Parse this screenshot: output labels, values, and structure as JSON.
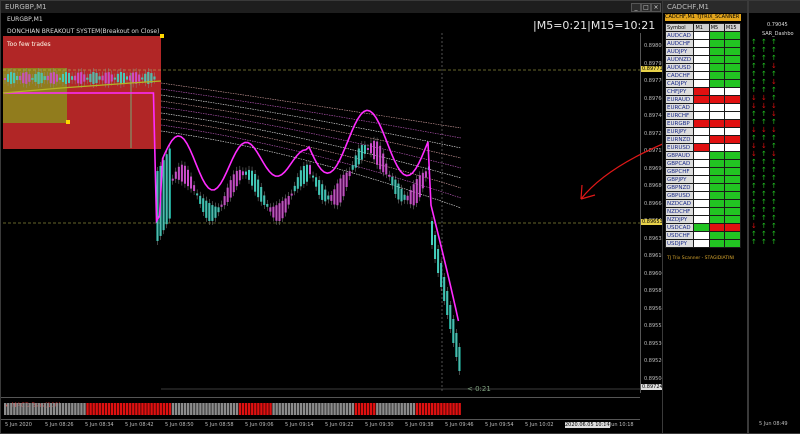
{
  "chart_window": {
    "title": "EURGBP,M1",
    "legend_line1": "EURGBP,M1",
    "indicator_name": "DONCHIAN BREAKOUT SYSTEM(Breakout on Close)",
    "box_label": "Too few trades",
    "timer_text": "|M5=0:21|M15=10:21",
    "countdown_label": "< 0:21",
    "macd_label": "► MACD Bars(100)",
    "price_axis": [
      "0.89808",
      "0.89792",
      "0.89776",
      "0.89760",
      "0.89744",
      "0.89728",
      "0.89712",
      "0.89696",
      "0.89680",
      "0.89664",
      "0.89648",
      "0.89632",
      "0.89616",
      "0.89600",
      "0.89584",
      "0.89568",
      "0.89552",
      "0.89536",
      "0.89520",
      "0.89504"
    ],
    "price_marker_upper": "0.89771",
    "price_marker_middle": "0.89653",
    "price_marker_lower": "0.89724",
    "time_axis": [
      "5 Jun 2020",
      "5 Jun 08:26",
      "5 Jun 08:34",
      "5 Jun 08:42",
      "5 Jun 08:50",
      "5 Jun 08:58",
      "5 Jun 09:06",
      "5 Jun 09:14",
      "5 Jun 09:22",
      "5 Jun 09:30",
      "5 Jun 09:38",
      "5 Jun 09:46",
      "5 Jun 09:54",
      "5 Jun 10:02",
      "2020.06.05 10:14",
      "5 Jun 10:18"
    ]
  },
  "scanner_window": {
    "title": "CADCHF,M1",
    "header": "CADCHF,M1 TJTRIX_SCANNER",
    "columns": [
      "Symbol",
      "M1",
      "M5",
      "M15"
    ],
    "rows": [
      {
        "symbol": "AUDCAD",
        "cells": [
          "w",
          "g",
          "g"
        ]
      },
      {
        "symbol": "AUDCHF",
        "cells": [
          "w",
          "g",
          "g"
        ]
      },
      {
        "symbol": "AUDJPY",
        "cells": [
          "w",
          "g",
          "g"
        ]
      },
      {
        "symbol": "AUDNZD",
        "cells": [
          "w",
          "g",
          "g"
        ]
      },
      {
        "symbol": "AUDUSD",
        "cells": [
          "w",
          "g",
          "g"
        ]
      },
      {
        "symbol": "CADCHF",
        "cells": [
          "w",
          "g",
          "g"
        ]
      },
      {
        "symbol": "CADJPY",
        "cells": [
          "w",
          "g",
          "g"
        ]
      },
      {
        "symbol": "CHFJPY",
        "cells": [
          "r",
          "w",
          "w"
        ]
      },
      {
        "symbol": "EURAUD",
        "cells": [
          "r",
          "r",
          "r"
        ]
      },
      {
        "symbol": "EURCAD",
        "cells": [
          "w",
          "w",
          "w"
        ]
      },
      {
        "symbol": "EURCHF",
        "cells": [
          "w",
          "w",
          "w"
        ]
      },
      {
        "symbol": "EURGBP",
        "cells": [
          "r",
          "r",
          "r"
        ]
      },
      {
        "symbol": "EURJPY",
        "cells": [
          "w",
          "w",
          "w"
        ]
      },
      {
        "symbol": "EURNZD",
        "cells": [
          "w",
          "r",
          "r"
        ]
      },
      {
        "symbol": "EURUSD",
        "cells": [
          "r",
          "w",
          "w"
        ]
      },
      {
        "symbol": "GBPAUD",
        "cells": [
          "w",
          "g",
          "g"
        ]
      },
      {
        "symbol": "GBPCAD",
        "cells": [
          "w",
          "g",
          "g"
        ]
      },
      {
        "symbol": "GBPCHF",
        "cells": [
          "w",
          "g",
          "g"
        ]
      },
      {
        "symbol": "GBPJPY",
        "cells": [
          "w",
          "g",
          "g"
        ]
      },
      {
        "symbol": "GBPNZD",
        "cells": [
          "w",
          "g",
          "g"
        ]
      },
      {
        "symbol": "GBPUSD",
        "cells": [
          "w",
          "g",
          "g"
        ]
      },
      {
        "symbol": "NZDCAD",
        "cells": [
          "w",
          "g",
          "g"
        ]
      },
      {
        "symbol": "NZDCHF",
        "cells": [
          "w",
          "g",
          "g"
        ]
      },
      {
        "symbol": "NZDJPY",
        "cells": [
          "w",
          "g",
          "g"
        ]
      },
      {
        "symbol": "USDCAD",
        "cells": [
          "g",
          "r",
          "r"
        ]
      },
      {
        "symbol": "USDCHF",
        "cells": [
          "w",
          "g",
          "g"
        ]
      },
      {
        "symbol": "USDJPY",
        "cells": [
          "w",
          "g",
          "g"
        ]
      }
    ],
    "footer": "TJ Trix Scanner - STAGIDIATINI"
  },
  "dashboard_window": {
    "label": "SAR_Dashbo",
    "price": "0.79045",
    "time_label": "5 Jun 08:49"
  },
  "colors": {
    "bull": "#2ee6cf",
    "bear": "#e23be2",
    "green": "#22c422",
    "red": "#e01010"
  }
}
